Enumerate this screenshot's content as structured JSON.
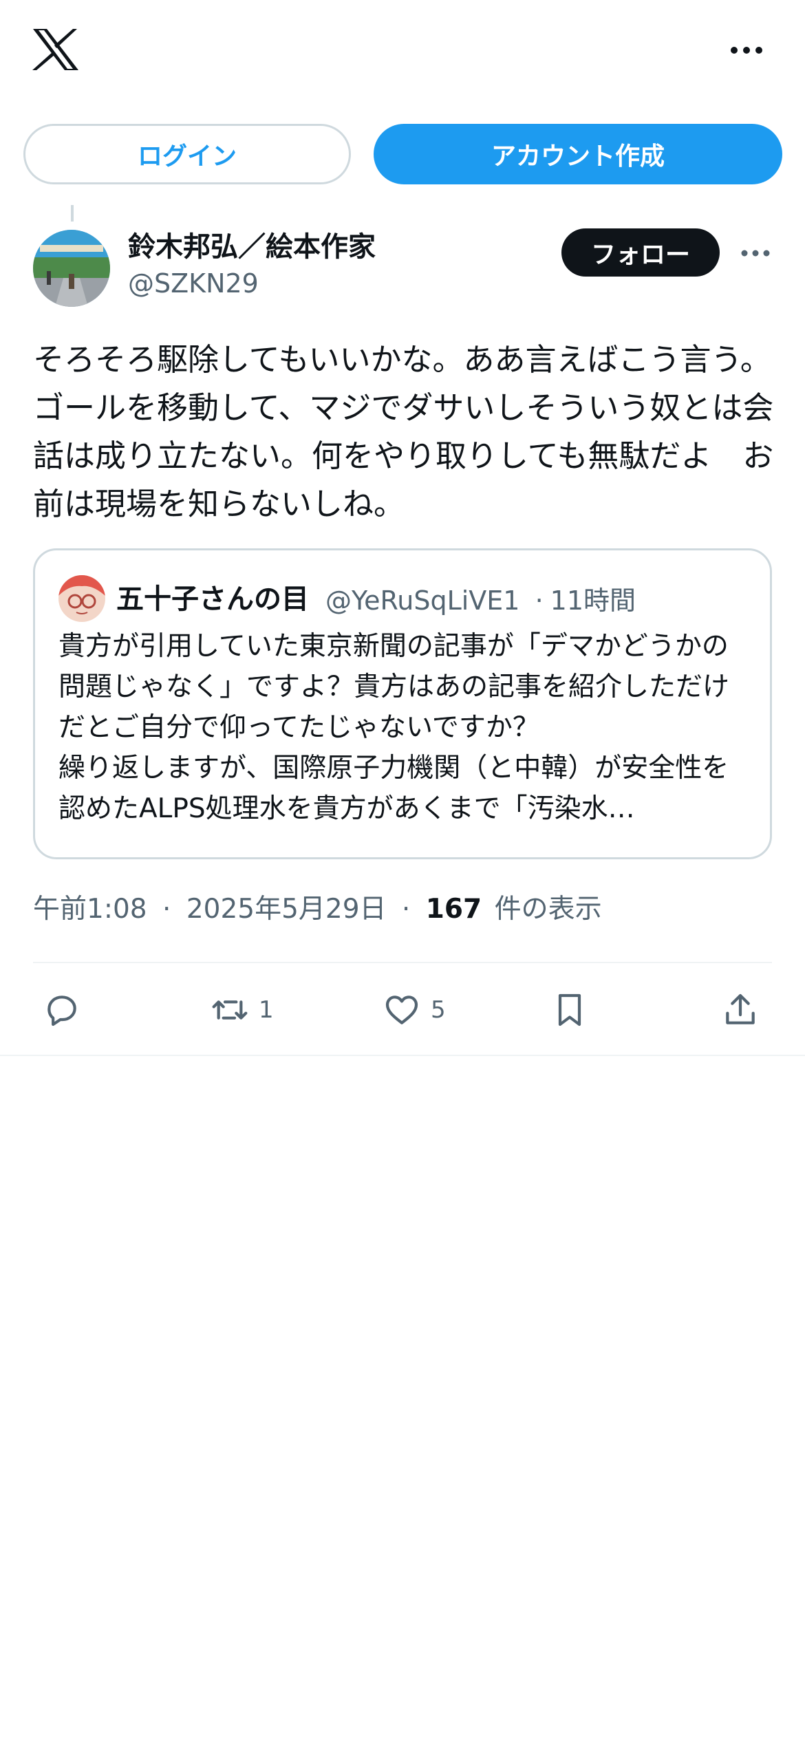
{
  "top_bar": {
    "logo_icon": "x-logo-icon",
    "more_icon": "more-horizontal-icon"
  },
  "auth": {
    "login_label": "ログイン",
    "signup_label": "アカウント作成"
  },
  "post": {
    "author_name": "鈴木邦弘／絵本作家",
    "author_handle": "@SZKN29",
    "follow_label": "フォロー",
    "text": "そろそろ駆除してもいいかな。ああ言えばこう言う。ゴールを移動して、マジでダサいしそういう奴とは会話は成り立たない。何をやり取りしても無駄だよ　お前は現場を知らないしね。",
    "quote": {
      "author_name": "五十子さんの目",
      "author_handle": "@YeRuSqLiVE1",
      "separator": "·",
      "time": "11時間",
      "text": "貴方が引用していた東京新聞の記事が「デマかどうかの問題じゃなく」ですよ？貴方はあの記事を紹介しただけだとご自分で仰ってたじゃないですか？\n繰り返しますが、国際原子力機関（と中韓）が安全性を認めたALPS処理水を貴方があくまで「汚染水…"
    },
    "time": "午前1:08",
    "date": "2025年5月29日",
    "separator": "·",
    "views_count": "167",
    "views_label": "件の表示"
  },
  "actions": {
    "reply_icon": "reply-icon",
    "retweet_icon": "retweet-icon",
    "retweet_count": "1",
    "like_icon": "heart-icon",
    "like_count": "5",
    "bookmark_icon": "bookmark-icon",
    "share_icon": "share-icon"
  },
  "colors": {
    "accent": "#1d9bf0",
    "text": "#0f1419",
    "secondary": "#536471",
    "border": "#cfd9de"
  }
}
